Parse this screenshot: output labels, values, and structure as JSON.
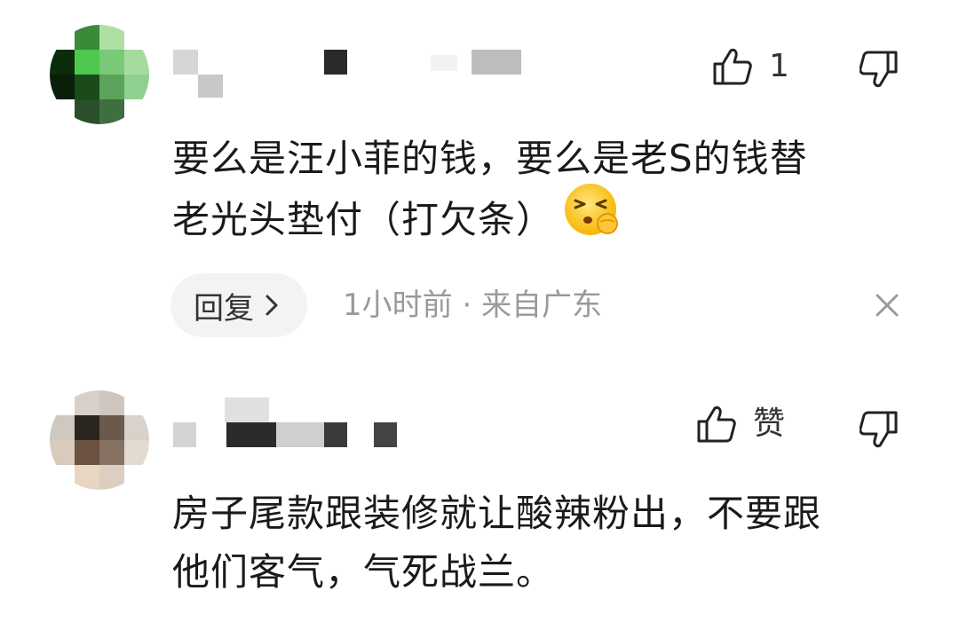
{
  "comments": [
    {
      "like_count": "1",
      "text_line1": "要么是汪小菲的钱，要么是老S的钱替",
      "text_line2": "老光头垫付（打欠条）",
      "emoji": "shushing-face-emoji",
      "reply_label": "回复",
      "meta": "1小时前 · 来自广东"
    },
    {
      "like_label": "赞",
      "text_line1": "房子尾款跟装修就让酸辣粉出，不要跟",
      "text_line2": "他们客气，气死战兰。"
    }
  ],
  "icons": {
    "like": "thumbs-up-icon",
    "dislike": "thumbs-down-icon",
    "reply_chevron": "chevron-right-icon",
    "close": "close-icon"
  },
  "colors": {
    "background": "#ffffff",
    "text": "#1a1a1a",
    "meta": "#9a9a9a",
    "reply_bg": "#f3f3f3"
  }
}
